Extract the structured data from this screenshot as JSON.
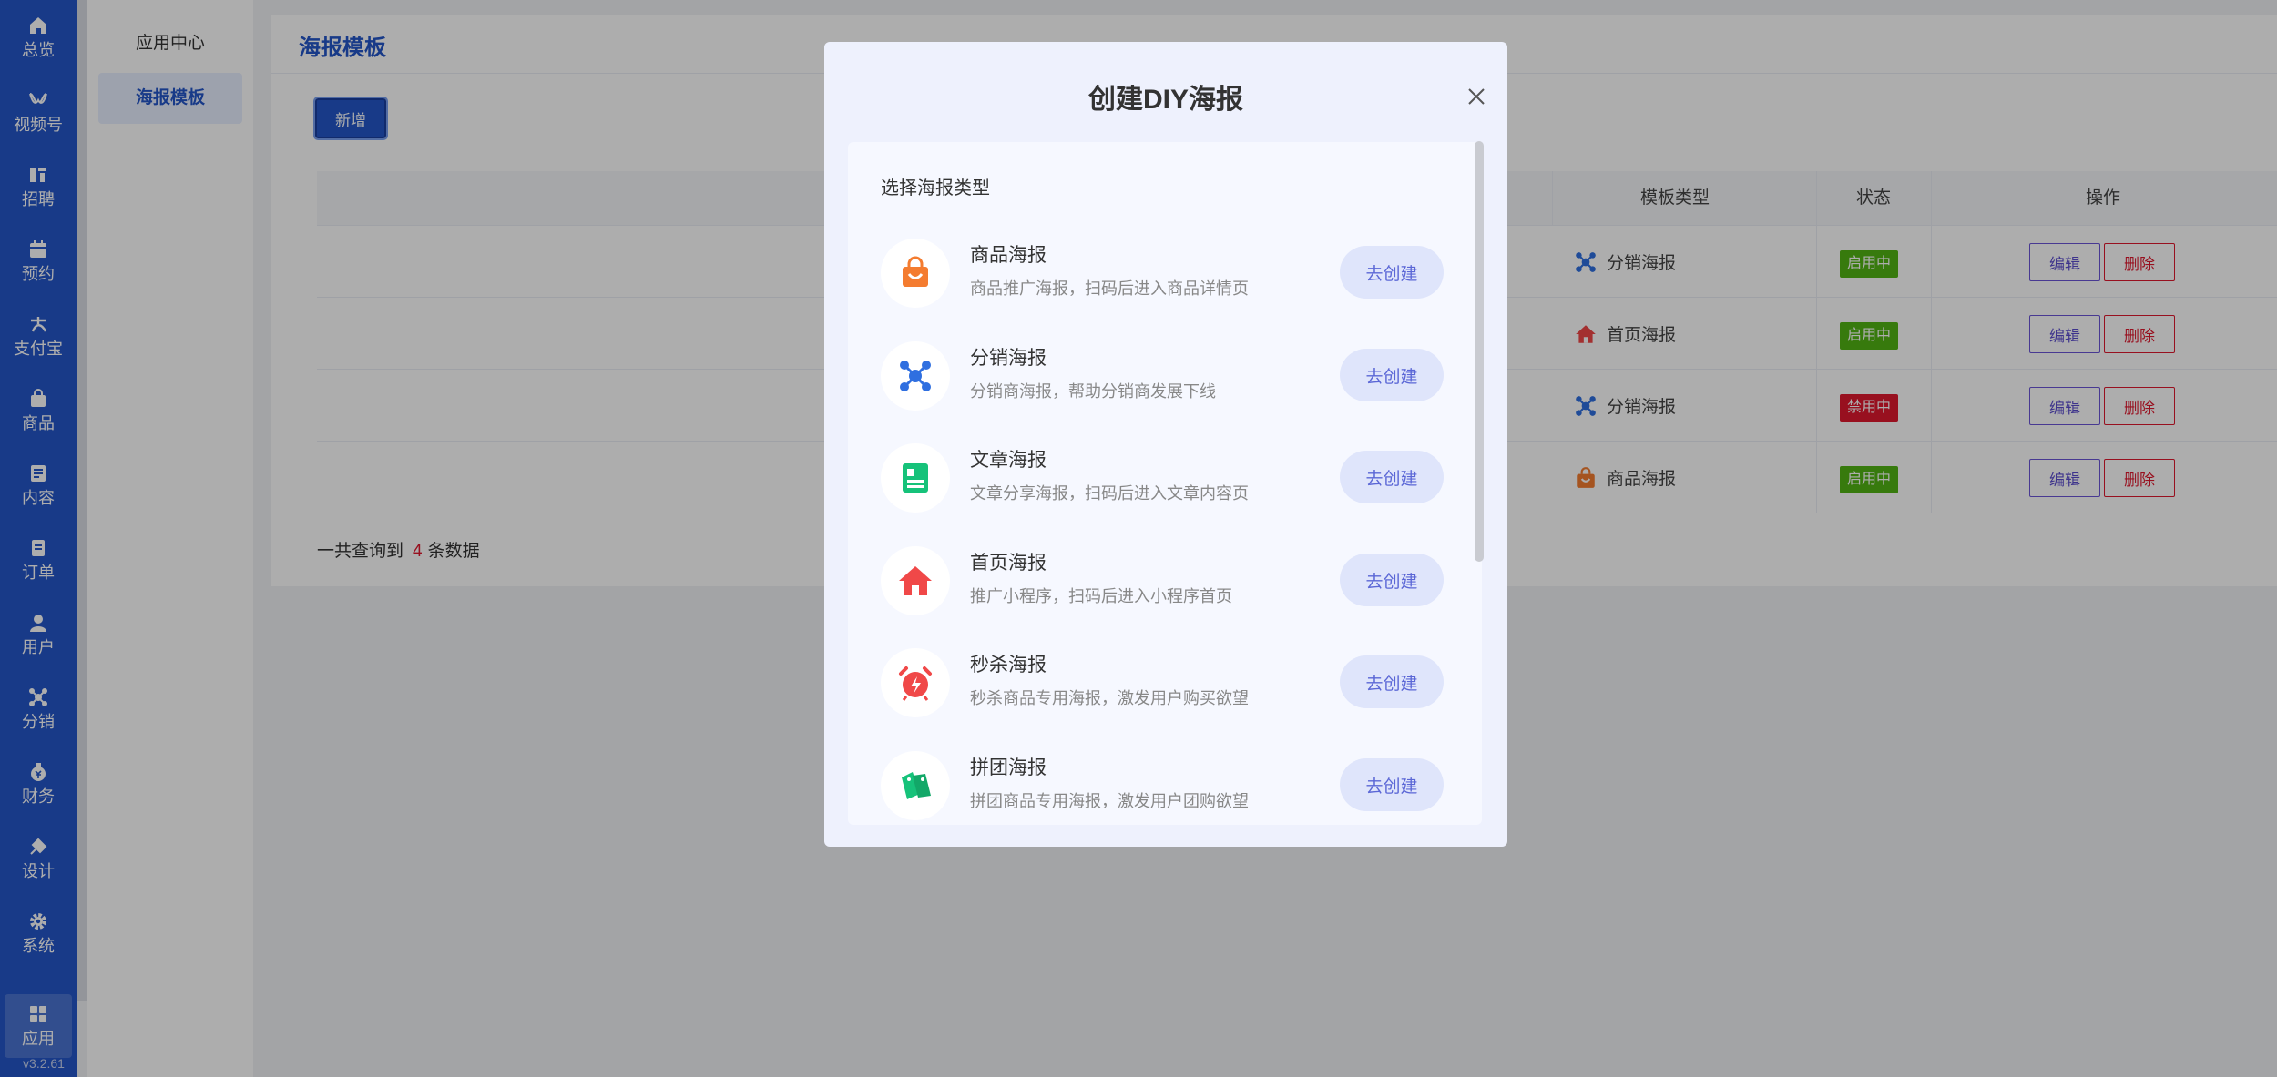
{
  "nav": {
    "items": [
      {
        "label": "总览",
        "icon": "home-icon"
      },
      {
        "label": "视频号",
        "icon": "video-channel-icon"
      },
      {
        "label": "招聘",
        "icon": "recruit-icon"
      },
      {
        "label": "预约",
        "icon": "calendar-icon"
      },
      {
        "label": "支付宝",
        "icon": "alipay-icon"
      },
      {
        "label": "商品",
        "icon": "goods-bag-icon"
      },
      {
        "label": "内容",
        "icon": "content-icon"
      },
      {
        "label": "订单",
        "icon": "order-icon"
      },
      {
        "label": "用户",
        "icon": "user-icon"
      },
      {
        "label": "分销",
        "icon": "distribution-icon"
      },
      {
        "label": "财务",
        "icon": "finance-icon"
      },
      {
        "label": "设计",
        "icon": "design-icon"
      },
      {
        "label": "系统",
        "icon": "gear-icon"
      },
      {
        "label": "应用",
        "icon": "apps-grid-icon"
      }
    ],
    "active_index": 13,
    "version": "v3.2.61"
  },
  "submenu": {
    "items": [
      "应用中心",
      "海报模板"
    ],
    "active_index": 1
  },
  "main": {
    "title": "海报模板",
    "add_label": "新增",
    "table": {
      "headers": {
        "type": "模板类型",
        "status": "状态",
        "actions": "操作"
      },
      "rows": [
        {
          "type": "分销海报",
          "type_icon": "distribution-icon",
          "status": "启用中",
          "enabled": true
        },
        {
          "type": "首页海报",
          "type_icon": "home-red-icon",
          "status": "启用中",
          "enabled": true
        },
        {
          "type": "分销海报",
          "type_icon": "distribution-icon",
          "status": "禁用中",
          "enabled": false
        },
        {
          "type": "商品海报",
          "type_icon": "goods-bag-icon",
          "status": "启用中",
          "enabled": true
        }
      ],
      "edit_label": "编辑",
      "delete_label": "删除"
    },
    "total": {
      "prefix": "一共查询到",
      "count": "4",
      "suffix": "条数据"
    }
  },
  "modal": {
    "title": "创建DIY海报",
    "section_label": "选择海报类型",
    "create_label": "去创建",
    "types": [
      {
        "name": "商品海报",
        "desc": "商品推广海报，扫码后进入商品详情页",
        "icon": "shopping-bag-icon",
        "color": "#f47c30"
      },
      {
        "name": "分销海报",
        "desc": "分销商海报，帮助分销商发展下线",
        "icon": "distribution-network-icon",
        "color": "#2f6fe0"
      },
      {
        "name": "文章海报",
        "desc": "文章分享海报，扫码后进入文章内容页",
        "icon": "article-icon",
        "color": "#16c27a"
      },
      {
        "name": "首页海报",
        "desc": "推广小程序，扫码后进入小程序首页",
        "icon": "home-red-icon",
        "color": "#f04848"
      },
      {
        "name": "秒杀海报",
        "desc": "秒杀商品专用海报，激发用户购买欲望",
        "icon": "alarm-clock-icon",
        "color": "#f04848"
      },
      {
        "name": "拼团海报",
        "desc": "拼团商品专用海报，激发用户团购欲望",
        "icon": "group-tags-icon",
        "color": "#16c27a"
      }
    ]
  }
}
